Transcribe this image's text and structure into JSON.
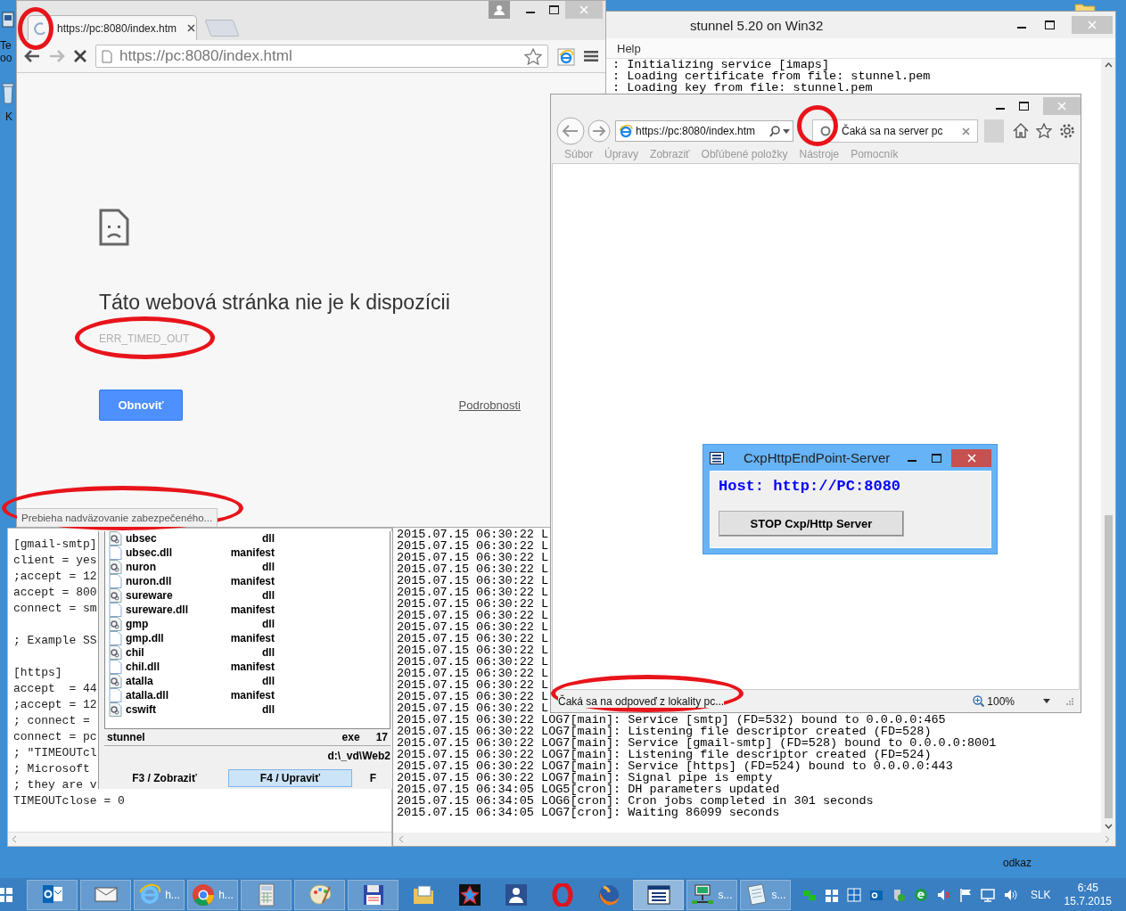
{
  "desktop": {
    "labels": [
      "Te",
      "oo",
      "K",
      "odkaz"
    ]
  },
  "editor": {
    "blocks": [
      [
        "[gmail-smtp]",
        "client = yes",
        ";accept = 12",
        "accept = 800",
        "connect = sm"
      ],
      [
        "; Example SS"
      ],
      [
        "[https]",
        "accept  = 44",
        ";accept = 12",
        "; connect = ",
        "connect = pc",
        "; \"TIMEOUTcl",
        "; Microsoft",
        "; they are v",
        "TIMEOUTclose = 0"
      ]
    ]
  },
  "stunnel": {
    "title": "stunnel 5.20 on Win32",
    "menu": [
      "Help"
    ],
    "log_top": [
      ": Initializing service [imaps]",
      ": Loading certificate from file: stunnel.pem",
      ": Loading key from file: stunnel.pem"
    ],
    "log_bottom": [
      "2015.07.15 06:30:22 L",
      "2015.07.15 06:30:22 L",
      "2015.07.15 06:30:22 L",
      "2015.07.15 06:30:22 L",
      "2015.07.15 06:30:22 L",
      "2015.07.15 06:30:22 L",
      "2015.07.15 06:30:22 L",
      "2015.07.15 06:30:22 L",
      "2015.07.15 06:30:22 L",
      "2015.07.15 06:30:22 L",
      "2015.07.15 06:30:22 L",
      "2015.07.15 06:30:22 L",
      "2015.07.15 06:30:22 L",
      "2015.07.15 06:30:22 L",
      "2015.07.15 06:30:22 L",
      "2015.07.15 06:30:22 L",
      "2015.07.15 06:30:22 LOG7[main]: Service [smtp] (FD=532) bound to 0.0.0.0:465",
      "2015.07.15 06:30:22 LOG7[main]: Listening file descriptor created (FD=528)",
      "2015.07.15 06:30:22 LOG7[main]: Service [gmail-smtp] (FD=528) bound to 0.0.0.0:8001",
      "2015.07.15 06:30:22 LOG7[main]: Listening file descriptor created (FD=524)",
      "2015.07.15 06:30:22 LOG7[main]: Service [https] (FD=524) bound to 0.0.0.0:443",
      "2015.07.15 06:30:22 LOG7[main]: Signal pipe is empty",
      "2015.07.15 06:34:05 LOG5[cron]: DH parameters updated",
      "2015.07.15 06:34:05 LOG6[cron]: Cron jobs completed in 301 seconds",
      "2015.07.15 06:34:05 LOG7[cron]: Waiting 86099 seconds"
    ]
  },
  "chrome": {
    "tab": {
      "title": "https://pc:8080/index.htm"
    },
    "address": "https://pc:8080/index.html",
    "error": {
      "title": "Táto webová stránka nie je k dispozícii",
      "code": "ERR_TIMED_OUT",
      "reload_button": "Obnoviť",
      "details_link": "Podrobnosti"
    },
    "status": "Prebieha nadväzovanie zabezpečeného..."
  },
  "file_manager": {
    "files": [
      {
        "name": "ubsec",
        "ext": "dll",
        "kind": "library"
      },
      {
        "name": "ubsec.dll",
        "ext": "manifest",
        "kind": "document"
      },
      {
        "name": "nuron",
        "ext": "dll",
        "kind": "library"
      },
      {
        "name": "nuron.dll",
        "ext": "manifest",
        "kind": "document"
      },
      {
        "name": "sureware",
        "ext": "dll",
        "kind": "library"
      },
      {
        "name": "sureware.dll",
        "ext": "manifest",
        "kind": "document"
      },
      {
        "name": "gmp",
        "ext": "dll",
        "kind": "library"
      },
      {
        "name": "gmp.dll",
        "ext": "manifest",
        "kind": "document"
      },
      {
        "name": "chil",
        "ext": "dll",
        "kind": "library"
      },
      {
        "name": "chil.dll",
        "ext": "manifest",
        "kind": "document"
      },
      {
        "name": "atalla",
        "ext": "dll",
        "kind": "library"
      },
      {
        "name": "atalla.dll",
        "ext": "manifest",
        "kind": "document"
      },
      {
        "name": "cswift",
        "ext": "dll",
        "kind": "library"
      }
    ],
    "current": {
      "name": "stunnel",
      "ext": "exe",
      "size": "17"
    },
    "path": "d:\\_vd\\Web2",
    "buttons": [
      {
        "label": "F3 / Zobraziť",
        "selected": false
      },
      {
        "label": "F4 / Upraviť",
        "selected": true
      },
      {
        "label": "F",
        "selected": false
      }
    ]
  },
  "ie": {
    "address": "https://pc:8080/index.htm",
    "tab": {
      "title": "Čaká sa na server pc"
    },
    "menu": [
      "Súbor",
      "Úpravy",
      "Zobraziť",
      "Obľúbené položky",
      "Nástroje",
      "Pomocník"
    ],
    "status": "Čaká sa na odpoveď z lokality pc...",
    "zoom": "100%"
  },
  "dialog": {
    "title": "CxpHttpEndPoint-Server",
    "host": "Host: http://PC:8080",
    "button": "STOP Cxp/Http Server"
  },
  "taskbar": {
    "items": [
      {
        "kind": "outlook",
        "running": true,
        "selected": false
      },
      {
        "kind": "mail",
        "running": true,
        "selected": false
      },
      {
        "kind": "ie",
        "label": "h...",
        "running": true,
        "selected": false
      },
      {
        "kind": "chrome",
        "label": "h...",
        "running": true,
        "selected": false
      },
      {
        "kind": "calculator",
        "running": true,
        "selected": false
      },
      {
        "kind": "paint",
        "running": true,
        "selected": false
      },
      {
        "kind": "floppy",
        "running": true,
        "selected": false
      },
      {
        "kind": "folder",
        "running": false,
        "selected": false
      },
      {
        "kind": "star",
        "running": false,
        "selected": false
      },
      {
        "kind": "person",
        "running": false,
        "selected": false
      },
      {
        "kind": "opera",
        "running": false,
        "selected": false
      },
      {
        "kind": "firefox",
        "running": false,
        "selected": false
      },
      {
        "kind": "window",
        "running": true,
        "selected": true
      },
      {
        "kind": "network",
        "label": "s...",
        "running": true,
        "selected": false
      },
      {
        "kind": "notepad",
        "label": "s...",
        "running": true,
        "selected": false
      }
    ],
    "language": "SLK",
    "time": "6:45",
    "date": "15.7.2015"
  }
}
